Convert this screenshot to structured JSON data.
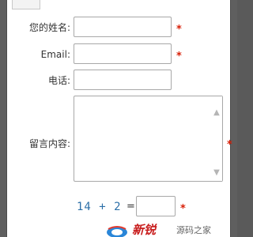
{
  "form": {
    "name_label": "您的姓名:",
    "name_value": "",
    "email_label": "Email:",
    "email_value": "",
    "phone_label": "电话:",
    "phone_value": "",
    "message_label": "留言内容:",
    "message_value": "",
    "required_mark": "*",
    "captcha_question": "14 + 2",
    "captcha_equals": "=",
    "captcha_value": ""
  },
  "watermark": {
    "brand_text": "新锐",
    "sub_text": "源码之家"
  },
  "colors": {
    "required": "#d81e06",
    "captcha_text": "#2c6fa8",
    "frame": "#5f5f5f"
  }
}
